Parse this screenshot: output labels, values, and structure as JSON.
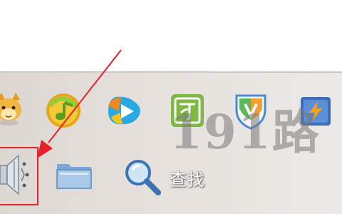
{
  "tray": {
    "row1": [
      {
        "icon": "qq-pet-icon"
      },
      {
        "icon": "kugou-music-icon"
      },
      {
        "icon": "video-player-icon"
      },
      {
        "icon": "green-app-icon"
      },
      {
        "icon": "security-shield-icon"
      },
      {
        "icon": "flash-app-icon"
      }
    ],
    "row2": [
      {
        "icon": "speaker-icon"
      },
      {
        "icon": "folder-icon"
      },
      {
        "icon": "search-icon",
        "label": "查找"
      }
    ]
  },
  "watermark": "191路",
  "colors": {
    "annotation_red": "#e8202a",
    "panel_bg": "#e6e1dd"
  }
}
